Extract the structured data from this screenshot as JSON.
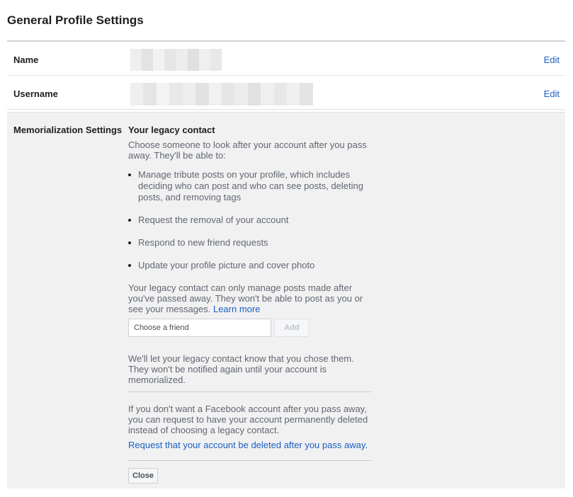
{
  "header": {
    "title": "General Profile Settings"
  },
  "name_row": {
    "label": "Name",
    "edit_label": "Edit"
  },
  "username_row": {
    "label": "Username",
    "edit_label": "Edit"
  },
  "memorialization": {
    "label": "Memorialization Settings",
    "legacy_title": "Your legacy contact",
    "intro": "Choose someone to look after your account after you pass away. They'll be able to:",
    "bullets": [
      "Manage tribute posts on your profile, which includes deciding who can post and who can see posts, deleting posts, and removing tags",
      "Request the removal of your account",
      "Respond to new friend requests",
      "Update your profile picture and cover photo"
    ],
    "manage_note": "Your legacy contact can only manage posts made after you've passed away. They won't be able to post as you or see your messages.",
    "learn_more": "Learn more",
    "friend_input_placeholder": "Choose a friend",
    "add_label": "Add",
    "notify_note": "We'll let your legacy contact know that you chose them. They won't be notified again until your account is memorialized.",
    "delete_note": "If you don't want a Facebook account after you pass away, you can request to have your account permanently deleted instead of choosing a legacy contact.",
    "delete_link": "Request that your account be deleted after you pass away.",
    "close_label": "Close"
  },
  "colors": {
    "link": "#1a5fc3",
    "panel_bg": "#f1f1f2",
    "text_primary": "#1c1e21",
    "text_secondary": "#606770"
  }
}
